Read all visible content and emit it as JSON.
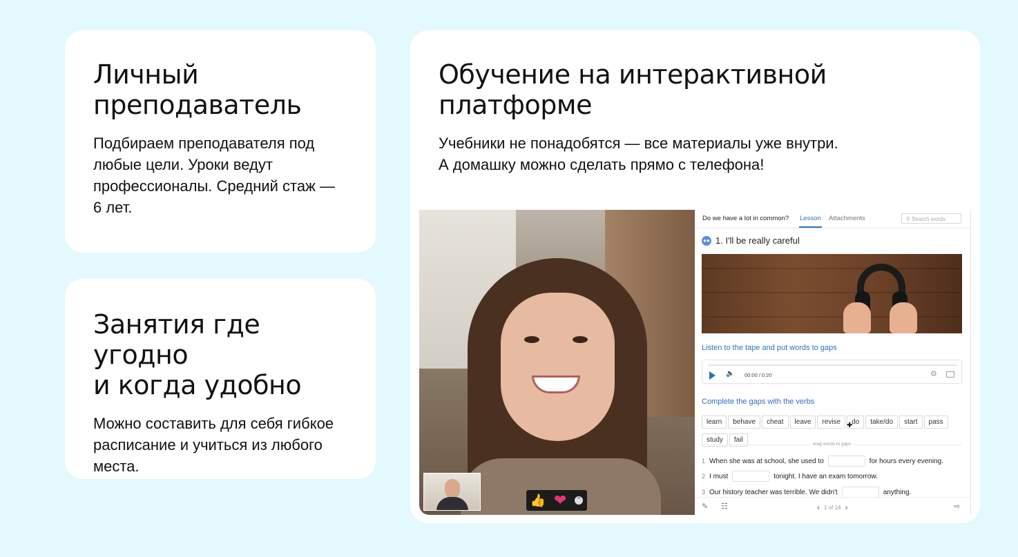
{
  "cards": {
    "tutor": {
      "title_line1": "Личный",
      "title_line2": "преподаватель",
      "text": "Подбираем преподавателя под любые цели. Уроки ведут профессионалы. Средний стаж — 6 лет."
    },
    "anywhere": {
      "title_line1": "Занятия где угодно",
      "title_line2": "и когда удобно",
      "text": "Можно составить для себя гибкое расписание и учиться из любого места."
    },
    "platform": {
      "title_line1": "Обучение на интерактивной",
      "title_line2": "платформе",
      "text_line1": "Учебники не понадобятся — все материалы уже внутри.",
      "text_line2": "А домашку можно сделать прямо с телефона!"
    }
  },
  "lesson": {
    "tabs": {
      "course": "Do we have a lot in common?",
      "lesson": "Lesson",
      "attachments": "Attachments"
    },
    "search_placeholder": "Search words",
    "exercise_title": "1. I'll be really careful",
    "listen_title": "Listen to the tape and put words to gaps",
    "player_time": "00:00 / 0:20",
    "complete_title": "Complete the gaps with the verbs",
    "words": [
      "learn",
      "behave",
      "cheat",
      "leave",
      "revise",
      "do",
      "take/do",
      "start",
      "pass",
      "study",
      "fail"
    ],
    "drag_hint": "drag words to gaps",
    "sentences": [
      {
        "num": "1",
        "before": "When she was at school, she used to",
        "after": "for hours every evening."
      },
      {
        "num": "2",
        "before": "I must",
        "after": "tonight. I have an exam tomorrow."
      },
      {
        "num": "3",
        "before": "Our history teacher was terrible. We didn't",
        "after": "anything."
      }
    ],
    "pager": "1 of 14"
  },
  "icons": {
    "play": "play-icon",
    "volume": "volume-icon",
    "settings": "gear-icon",
    "captions": "captions-icon",
    "pencil": "pencil-icon",
    "notes": "notes-icon",
    "exit": "exit-icon",
    "thumbs_up": "thumbs-up-icon",
    "heart": "heart-icon"
  },
  "colors": {
    "background": "#e3f9fd",
    "card": "#ffffff",
    "accent": "#2f6fbf"
  }
}
